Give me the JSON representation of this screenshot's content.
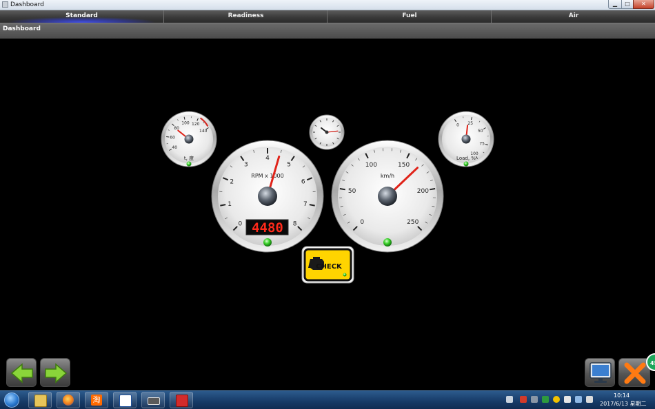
{
  "window": {
    "title": "Dashboard"
  },
  "tabs": [
    {
      "label": "Standard",
      "active": true
    },
    {
      "label": "Readiness",
      "active": false
    },
    {
      "label": "Fuel",
      "active": false
    },
    {
      "label": "Air",
      "active": false
    }
  ],
  "section": {
    "title": "Dashboard"
  },
  "gauges": {
    "coolant": {
      "ticks": [
        "40",
        "60",
        "80",
        "100",
        "120",
        "140"
      ],
      "unit_label": "t, 度",
      "value": 78
    },
    "clock": {
      "hour": 10,
      "minute": 14
    },
    "load": {
      "ticks": [
        "0",
        "25",
        "50",
        "75",
        "100"
      ],
      "unit_label": "Load, %",
      "value": 20
    },
    "rpm": {
      "ticks": [
        "0",
        "1",
        "2",
        "3",
        "4",
        "5",
        "6",
        "7",
        "8"
      ],
      "unit_label": "RPM x 1000",
      "value": 4.48,
      "display": "4480"
    },
    "speed": {
      "ticks": [
        "0",
        "50",
        "100",
        "150",
        "200",
        "250"
      ],
      "unit_label": "km/h",
      "value": 168
    },
    "warning": {
      "label": "CHECK"
    }
  },
  "badge": {
    "label": "45"
  },
  "taskbar": {
    "apps": [
      "file-explorer",
      "firefox",
      "taobao",
      "diagnostic-app",
      "chip-tool",
      "toolbox-app"
    ],
    "time": "10:14",
    "date": "2017/6/13 星期二"
  },
  "colors": {
    "accent": "#2f3fd6",
    "needle": "#e0241a",
    "display_digits": "#ff2a1a",
    "check_light": "#ffd400"
  }
}
